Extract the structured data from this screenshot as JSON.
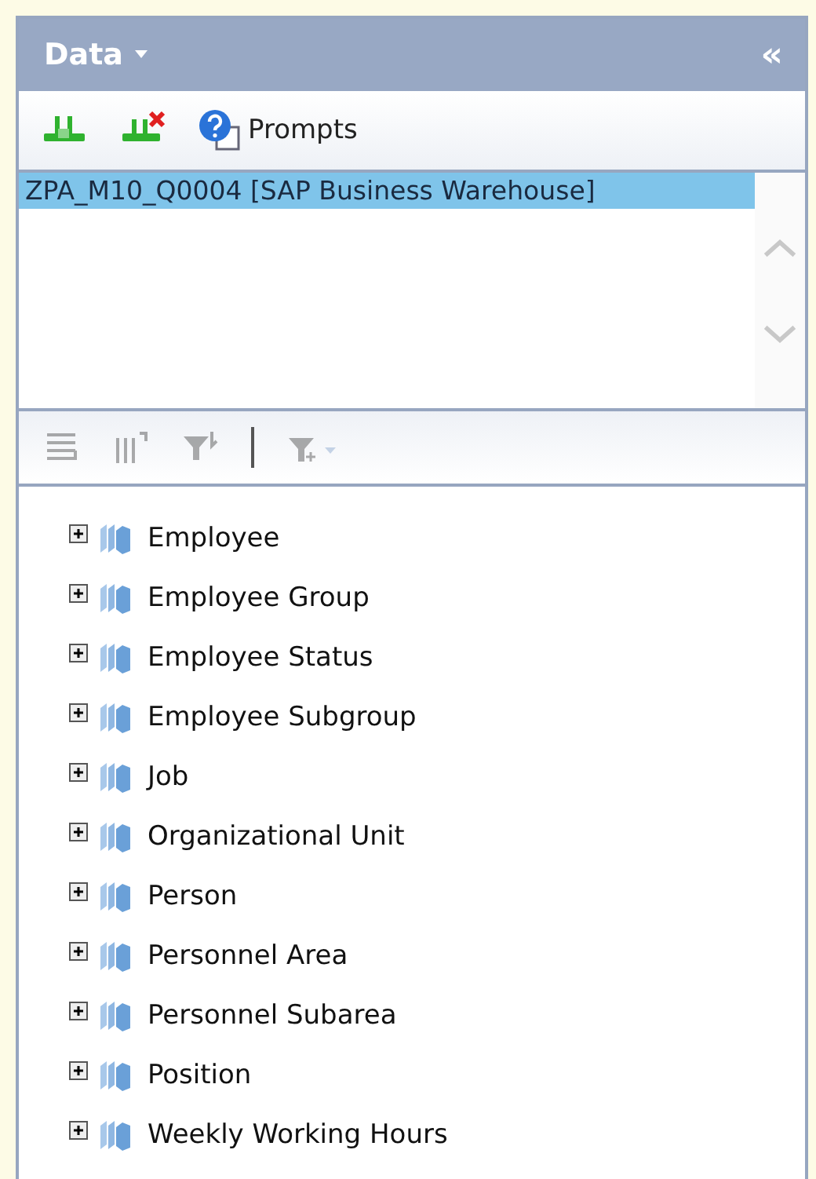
{
  "panel": {
    "title": "Data",
    "collapse_glyph": "«"
  },
  "toolbar": {
    "prompts_label": "Prompts"
  },
  "sources": [
    {
      "label": "ZPA_M10_Q0004 [SAP Business Warehouse]",
      "selected": true
    }
  ],
  "tree_toolbar": [
    {
      "kind": "rows",
      "disabled": true
    },
    {
      "kind": "columns",
      "disabled": true
    },
    {
      "kind": "filter",
      "disabled": true
    },
    {
      "kind": "separator"
    },
    {
      "kind": "add-filter",
      "disabled": true
    }
  ],
  "tree": [
    {
      "label": "Employee",
      "expanded": false
    },
    {
      "label": "Employee Group",
      "expanded": false
    },
    {
      "label": "Employee Status",
      "expanded": false
    },
    {
      "label": "Employee Subgroup",
      "expanded": false
    },
    {
      "label": "Job",
      "expanded": false
    },
    {
      "label": "Organizational Unit",
      "expanded": false
    },
    {
      "label": "Person",
      "expanded": false
    },
    {
      "label": "Personnel Area",
      "expanded": false
    },
    {
      "label": "Personnel Subarea",
      "expanded": false
    },
    {
      "label": "Position",
      "expanded": false
    },
    {
      "label": "Weekly Working Hours",
      "expanded": false
    }
  ]
}
